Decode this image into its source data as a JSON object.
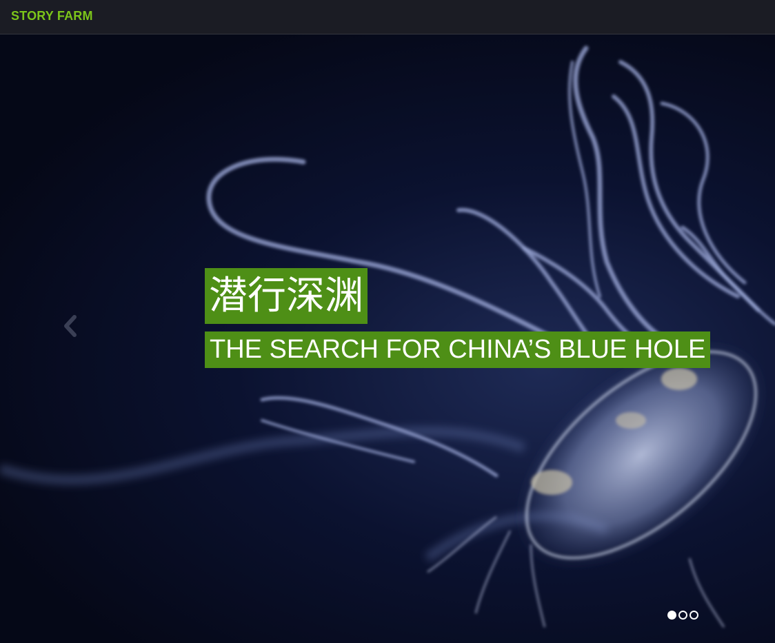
{
  "navbar": {
    "brand": "STORY FARM"
  },
  "hero": {
    "title_cn": "潜行深渊",
    "title_en": "THE SEARCH FOR CHINA’S BLUE HOLE",
    "slides": [
      {
        "active": true
      },
      {
        "active": false
      },
      {
        "active": false
      }
    ],
    "prev_icon": "chevron-left-icon"
  },
  "colors": {
    "brand": "#7cc51a",
    "caption_bg": "#4e8f16",
    "navbar_bg": "#1b1c24"
  }
}
